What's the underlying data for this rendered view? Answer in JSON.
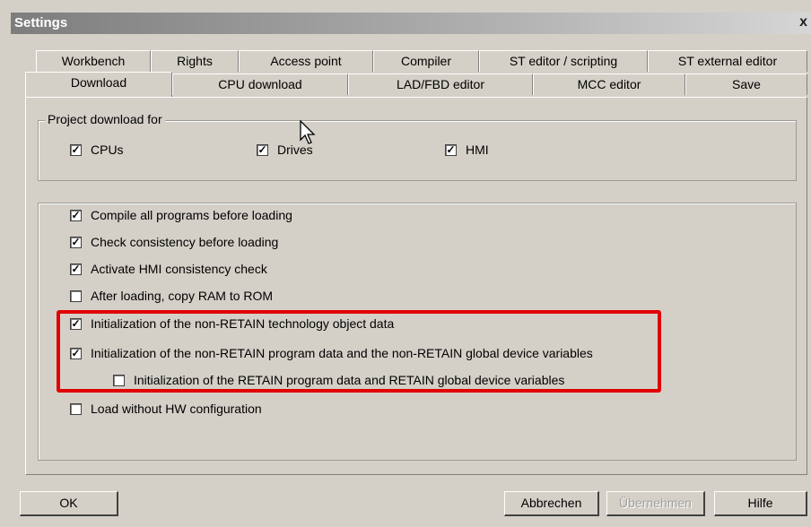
{
  "window": {
    "title": "Settings",
    "close_glyph": "x"
  },
  "tabs_row1": [
    "Workbench",
    "Rights",
    "Access point",
    "Compiler",
    "ST editor / scripting",
    "ST external editor"
  ],
  "tabs_row2": [
    "Download",
    "CPU download",
    "LAD/FBD editor",
    "MCC editor",
    "Save"
  ],
  "active_tab": "Download",
  "project_download": {
    "legend": "Project download for",
    "items": [
      {
        "label": "CPUs",
        "checked": true
      },
      {
        "label": "Drives",
        "checked": true
      },
      {
        "label": "HMI",
        "checked": true
      }
    ]
  },
  "options": [
    {
      "label": "Compile all programs before loading",
      "checked": true
    },
    {
      "label": "Check consistency before loading",
      "checked": true
    },
    {
      "label": "Activate HMI consistency check",
      "checked": true
    },
    {
      "label": "After loading, copy RAM to ROM",
      "checked": false
    },
    {
      "label": "Initialization of the non-RETAIN technology object data",
      "checked": true
    },
    {
      "label": "Initialization of the non-RETAIN program data and the non-RETAIN global device variables",
      "checked": true
    },
    {
      "label": "Initialization of the RETAIN program data and RETAIN global device variables",
      "checked": false
    },
    {
      "label": "Load without HW configuration",
      "checked": false
    }
  ],
  "buttons": {
    "ok": "OK",
    "cancel": "Abbrechen",
    "apply": "Übernehmen",
    "help": "Hilfe"
  },
  "check_glyph": "✓",
  "highlight_color": "#e00000"
}
